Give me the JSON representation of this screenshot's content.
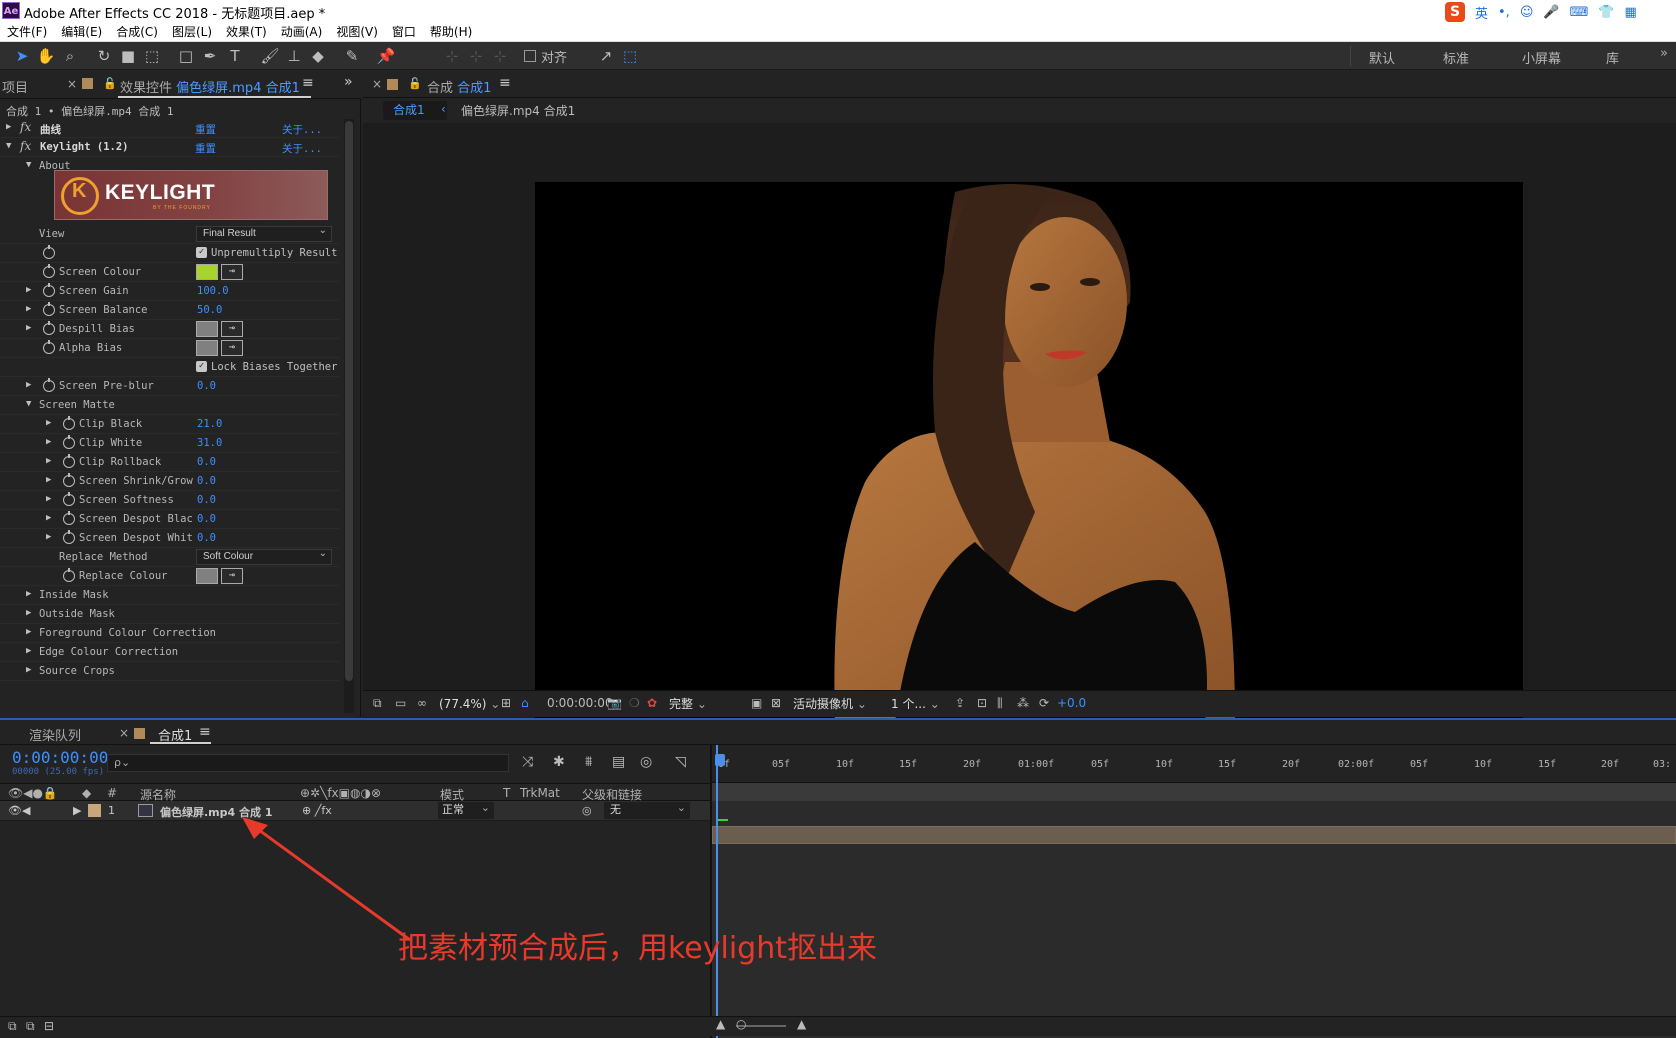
{
  "titlebar": {
    "app_badge": "Ae",
    "title": "Adobe After Effects CC 2018 - 无标题项目.aep *",
    "ime_items": [
      "S",
      "英",
      "•,",
      "☺",
      "🎤",
      "⌨",
      "👕",
      "▦"
    ]
  },
  "menu": [
    "文件(F)",
    "编辑(E)",
    "合成(C)",
    "图层(L)",
    "效果(T)",
    "动画(A)",
    "视图(V)",
    "窗口",
    "帮助(H)"
  ],
  "toolbar": {
    "align_label": "对齐",
    "workspaces": [
      "默认",
      "标准",
      "小屏幕",
      "库"
    ],
    "more": "»"
  },
  "left_panel": {
    "tab_project": "项目",
    "tab_effects_prefix": "效果控件 ",
    "tab_effects_name": "偏色绿屏.mp4 合成1",
    "breadcrumb": "合成 1 • 偏色绿屏.mp4 合成 1",
    "banner_text": "KEYLIGHT",
    "banner_sub": "BY THE FOUNDRY",
    "rows": [
      {
        "label": "曲线",
        "reset": "重置",
        "about": "关于..."
      },
      {
        "label": "Keylight (1.2)",
        "reset": "重置",
        "about": "关于..."
      },
      {
        "label": "About"
      },
      {
        "label": "View",
        "dropdown": "Final Result"
      },
      {
        "label": "Unpremultiply Result"
      },
      {
        "label": "Screen Colour",
        "color": "#a6d42c"
      },
      {
        "label": "Screen Gain",
        "value": "100.0"
      },
      {
        "label": "Screen Balance",
        "value": "50.0"
      },
      {
        "label": "Despill Bias",
        "color": "#808080"
      },
      {
        "label": "Alpha Bias",
        "color": "#808080"
      },
      {
        "label": "Lock Biases Together"
      },
      {
        "label": "Screen Pre-blur",
        "value": "0.0"
      },
      {
        "label": "Screen Matte"
      },
      {
        "label": "Clip Black",
        "value": "21.0"
      },
      {
        "label": "Clip White",
        "value": "31.0"
      },
      {
        "label": "Clip Rollback",
        "value": "0.0"
      },
      {
        "label": "Screen Shrink/Grow",
        "value": "0.0"
      },
      {
        "label": "Screen Softness",
        "value": "0.0"
      },
      {
        "label": "Screen Despot Blac",
        "value": "0.0"
      },
      {
        "label": "Screen Despot Whit",
        "value": "0.0"
      },
      {
        "label": "Replace Method",
        "dropdown": "Soft Colour"
      },
      {
        "label": "Replace Colour",
        "color": "#808080"
      },
      {
        "label": "Inside Mask"
      },
      {
        "label": "Outside Mask"
      },
      {
        "label": "Foreground Colour Correction"
      },
      {
        "label": "Edge Colour Correction"
      },
      {
        "label": "Source Crops"
      }
    ]
  },
  "viewer": {
    "tab_prefix": "合成 ",
    "tab_name": "合成1",
    "crumb_active": "合成1",
    "crumb_arrow": "‹",
    "crumb_next": "偏色绿屏.mp4 合成1",
    "zoom": "(77.4%)",
    "timecode": "0:00:00:00",
    "resolution": "完整",
    "camera": "活动摄像机",
    "views": "1 个...",
    "exposure": "+0.0"
  },
  "timeline": {
    "tab_render": "渲染队列",
    "tab_comp": "合成1",
    "timecode": "0:00:00:00",
    "fps": "00000 (25.00 fps)",
    "search_placeholder": "ρ⌄",
    "headers": {
      "num": "#",
      "source": "源名称",
      "mode": "模式",
      "t": "T",
      "trkmat": "TrkMat",
      "parent": "父级和链接"
    },
    "layer": {
      "num": "1",
      "name": "偏色绿屏.mp4 合成 1",
      "mode": "正常",
      "parent": "无"
    },
    "ruler": [
      "0f",
      "05f",
      "10f",
      "15f",
      "20f",
      "01:00f",
      "05f",
      "10f",
      "15f",
      "20f",
      "02:00f",
      "05f",
      "10f",
      "15f",
      "20f",
      "03:"
    ]
  },
  "annotation": {
    "text": "把素材预合成后，用keylight抠出来",
    "color": "#e83a2a"
  }
}
